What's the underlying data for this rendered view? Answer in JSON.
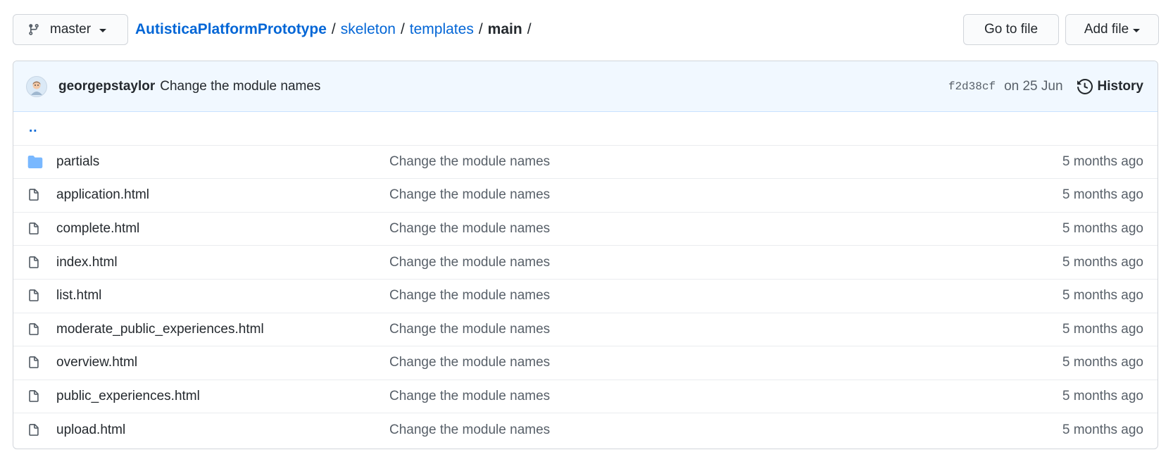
{
  "branch": {
    "label": "master",
    "icon": "git-branch-icon"
  },
  "breadcrumb": {
    "repo": "AutisticaPlatformPrototype",
    "sep": "/",
    "path1": "skeleton",
    "path2": "templates",
    "current": "main"
  },
  "buttons": {
    "go_to_file": "Go to file",
    "add_file": "Add file"
  },
  "commit": {
    "author": "georgepstaylor",
    "message": "Change the module names",
    "sha": "f2d38cf",
    "date": "on 25 Jun",
    "history_label": "History"
  },
  "parent_link": "..",
  "files": [
    {
      "name": "partials",
      "type": "folder",
      "message": "Change the module names",
      "age": "5 months ago"
    },
    {
      "name": "application.html",
      "type": "file",
      "message": "Change the module names",
      "age": "5 months ago"
    },
    {
      "name": "complete.html",
      "type": "file",
      "message": "Change the module names",
      "age": "5 months ago"
    },
    {
      "name": "index.html",
      "type": "file",
      "message": "Change the module names",
      "age": "5 months ago"
    },
    {
      "name": "list.html",
      "type": "file",
      "message": "Change the module names",
      "age": "5 months ago"
    },
    {
      "name": "moderate_public_experiences.html",
      "type": "file",
      "message": "Change the module names",
      "age": "5 months ago"
    },
    {
      "name": "overview.html",
      "type": "file",
      "message": "Change the module names",
      "age": "5 months ago"
    },
    {
      "name": "public_experiences.html",
      "type": "file",
      "message": "Change the module names",
      "age": "5 months ago"
    },
    {
      "name": "upload.html",
      "type": "file",
      "message": "Change the module names",
      "age": "5 months ago"
    }
  ],
  "colors": {
    "link": "#0366d6",
    "folder": "#79b8ff",
    "commit_bar": "#f1f8ff",
    "muted": "#586069"
  }
}
